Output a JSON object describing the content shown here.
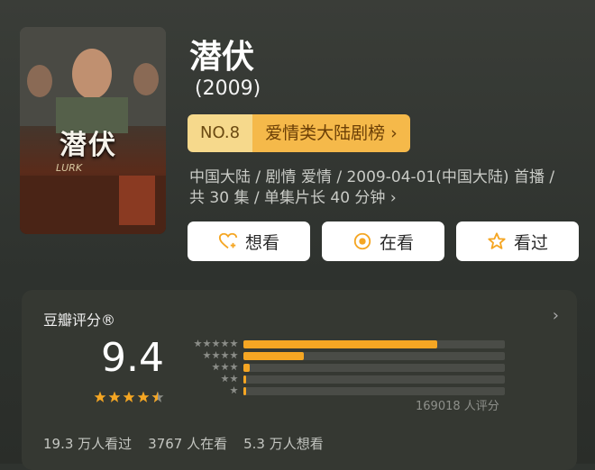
{
  "movie": {
    "title": "潜伏",
    "year": "(2009)",
    "poster_title": "潜伏",
    "poster_sub": "LURK",
    "rank_no": "NO.8",
    "rank_name": "爱情类大陆剧榜",
    "meta_line1": "中国大陆 / 剧情 爱情 / 2009-04-01(中国大陆) 首播 /",
    "meta_line2": "共 30 集 / 单集片长 40 分钟 ›"
  },
  "actions": {
    "want": "想看",
    "watching": "在看",
    "watched": "看过"
  },
  "rating": {
    "label": "豆瓣评分®",
    "score": "9.4",
    "stars": 4.5,
    "distribution": [
      {
        "stars": 5,
        "fraction": 0.74
      },
      {
        "stars": 4,
        "fraction": 0.23
      },
      {
        "stars": 3,
        "fraction": 0.025
      },
      {
        "stars": 2,
        "fraction": 0.01
      },
      {
        "stars": 1,
        "fraction": 0.01
      }
    ],
    "raters": "169018 人评分"
  },
  "stats": {
    "watched": "19.3 万人看过",
    "watching": "3767 人在看",
    "want": "5.3 万人想看"
  },
  "colors": {
    "accent": "#f5a623",
    "rank_bg": "#f5b94a"
  }
}
